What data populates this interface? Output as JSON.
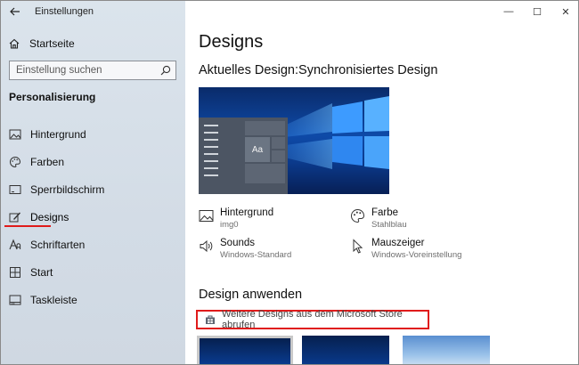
{
  "window": {
    "title": "Einstellungen",
    "controls": {
      "minimize": "—",
      "maximize": "☐",
      "close": "✕"
    }
  },
  "sidebar": {
    "home_label": "Startseite",
    "search_placeholder": "Einstellung suchen",
    "section_title": "Personalisierung",
    "items": [
      {
        "label": "Hintergrund",
        "icon": "image-icon"
      },
      {
        "label": "Farben",
        "icon": "palette-icon"
      },
      {
        "label": "Sperrbildschirm",
        "icon": "lockscreen-icon"
      },
      {
        "label": "Designs",
        "icon": "brush-icon",
        "active": true
      },
      {
        "label": "Schriftarten",
        "icon": "font-icon"
      },
      {
        "label": "Start",
        "icon": "start-icon"
      },
      {
        "label": "Taskleiste",
        "icon": "taskbar-icon"
      }
    ]
  },
  "main": {
    "page_title": "Designs",
    "current_design_label": "Aktuelles Design:",
    "current_design_value": "Synchronisiertes Design",
    "preview_tile_text": "Aa",
    "properties": [
      {
        "label": "Hintergrund",
        "value": "img0",
        "icon": "image-icon"
      },
      {
        "label": "Farbe",
        "value": "Stahlblau",
        "icon": "palette-icon"
      },
      {
        "label": "Sounds",
        "value": "Windows-Standard",
        "icon": "speaker-icon"
      },
      {
        "label": "Mauszeiger",
        "value": "Windows-Voreinstellung",
        "icon": "cursor-icon"
      }
    ],
    "apply_title": "Design anwenden",
    "store_link": "Weitere Designs aus dem Microsoft Store abrufen"
  },
  "colors": {
    "accent_red": "#e01b1b",
    "sidebar_bg": "#d8e1ea"
  }
}
